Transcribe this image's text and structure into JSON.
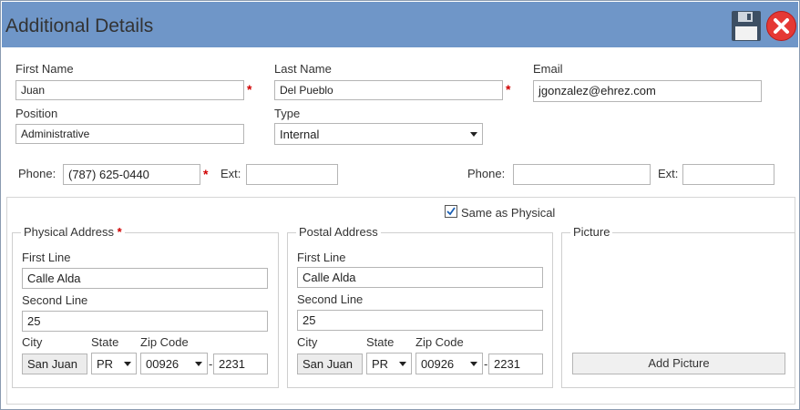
{
  "window": {
    "title": "Additional Details"
  },
  "toolbar": {
    "save_icon": "floppy-disk-icon",
    "close_icon": "close-circle-icon",
    "accent": "#6f96c8",
    "close_color": "#e53935"
  },
  "form": {
    "first_name": {
      "label": "First Name",
      "value": "Juan"
    },
    "last_name": {
      "label": "Last Name",
      "value": "Del Pueblo"
    },
    "email": {
      "label": "Email",
      "value": "jgonzalez@ehrez.com"
    },
    "position": {
      "label": "Position",
      "value": "Administrative"
    },
    "type": {
      "label": "Type",
      "value": "Internal"
    },
    "phone1": {
      "label": "Phone:",
      "value": "(787) 625-0440",
      "ext_label": "Ext:",
      "ext_value": ""
    },
    "phone2": {
      "label": "Phone:",
      "value": "",
      "ext_label": "Ext:",
      "ext_value": ""
    },
    "required_mark": "*"
  },
  "same_as_physical": {
    "label": "Same as Physical",
    "checked": true
  },
  "physical": {
    "legend": "Physical Address",
    "first_line_label": "First Line",
    "first_line": "Calle Alda",
    "second_line_label": "Second Line",
    "second_line": "25",
    "city_label": "City",
    "city": "San Juan",
    "state_label": "State",
    "state": "PR",
    "zip_label": "Zip Code",
    "zip": "00926",
    "zip_ext": "2231",
    "dash": "-"
  },
  "postal": {
    "legend": "Postal Address",
    "first_line_label": "First Line",
    "first_line": "Calle Alda",
    "second_line_label": "Second Line",
    "second_line": "25",
    "city_label": "City",
    "city": "San Juan",
    "state_label": "State",
    "state": "PR",
    "zip_label": "Zip Code",
    "zip": "00926",
    "zip_ext": "2231",
    "dash": "-"
  },
  "picture": {
    "legend": "Picture",
    "button_label": "Add Picture"
  }
}
